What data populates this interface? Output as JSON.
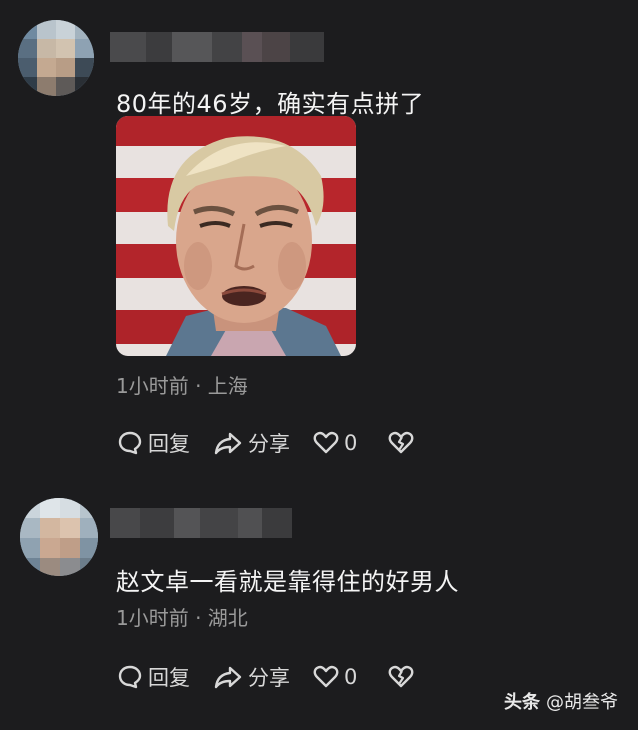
{
  "comments": [
    {
      "text": "80年的46岁，确实有点拼了",
      "time_location": "1小时前 · 上海",
      "actions": {
        "reply_label": "回复",
        "share_label": "分享",
        "like_count": "0"
      }
    },
    {
      "text": "赵文卓一看就是靠得住的好男人",
      "time_location": "1小时前 · 湖北",
      "actions": {
        "reply_label": "回复",
        "share_label": "分享",
        "like_count": "0"
      }
    }
  ],
  "watermark": {
    "brand": "头条",
    "handle": "@胡叁爷"
  },
  "icons": {
    "reply": "speech-bubble-icon",
    "share": "share-arrow-icon",
    "like": "heart-icon",
    "dislike": "broken-heart-icon"
  },
  "colors": {
    "background": "#1c1c1e",
    "text": "#f4f4f4",
    "meta": "#9a9a9a",
    "action": "#d8d8d8"
  }
}
